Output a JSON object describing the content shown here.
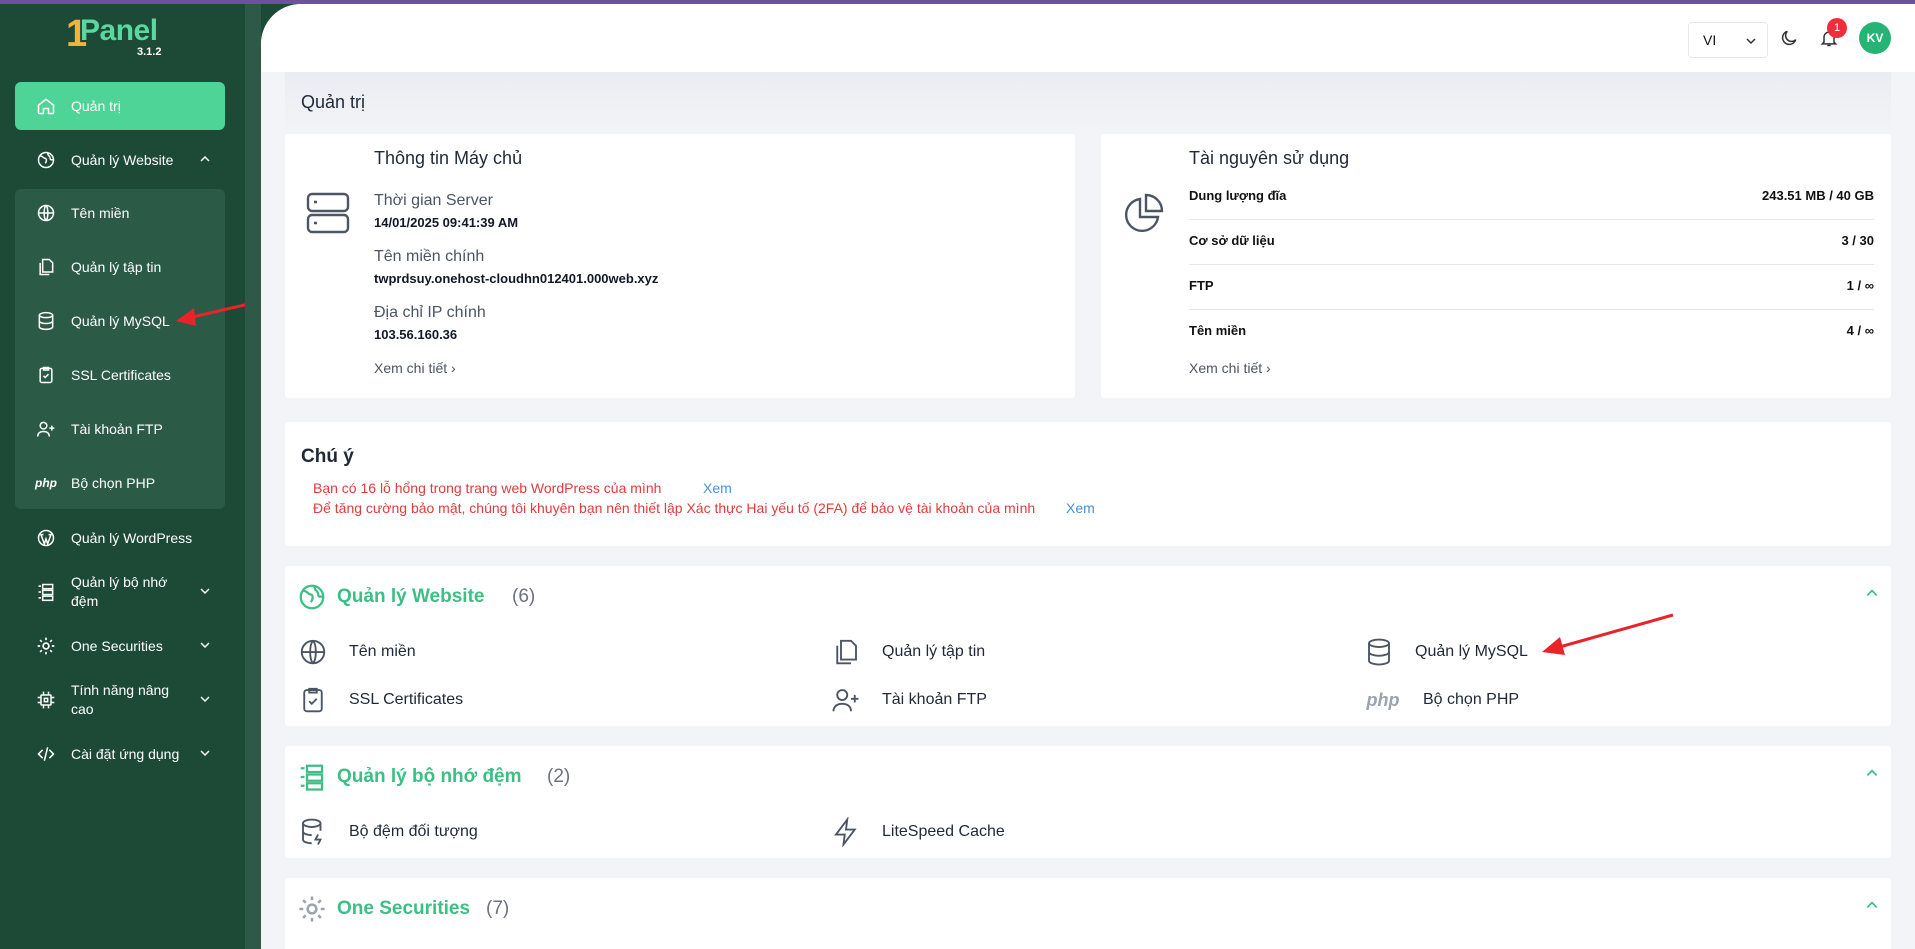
{
  "app": {
    "logo_one": "1",
    "logo_text": "Panel",
    "version": "3.1.2"
  },
  "sidebar": {
    "items": [
      {
        "label": "Quản trị",
        "icon": "home-icon"
      },
      {
        "label": "Quản lý Website",
        "icon": "globe-leaf-icon"
      },
      {
        "label": "Tên miền",
        "icon": "globe-icon"
      },
      {
        "label": "Quản lý tập tin",
        "icon": "files-icon"
      },
      {
        "label": "Quản lý MySQL",
        "icon": "database-icon"
      },
      {
        "label": "SSL Certificates",
        "icon": "clipboard-check-icon"
      },
      {
        "label": "Tài khoản FTP",
        "icon": "user-plus-icon"
      },
      {
        "label": "Bộ chọn PHP",
        "icon": "php-icon"
      },
      {
        "label": "Quản lý WordPress",
        "icon": "wordpress-icon"
      },
      {
        "label": "Quản lý bộ nhớ đệm",
        "icon": "cache-server-icon"
      },
      {
        "label": "One Securities",
        "icon": "gear-icon"
      },
      {
        "label": "Tính năng nâng cao",
        "icon": "chip-icon"
      },
      {
        "label": "Cài đặt ứng dụng",
        "icon": "code-icon"
      }
    ]
  },
  "topbar": {
    "language": "VI",
    "notification_count": "1",
    "avatar_initials": "KV"
  },
  "page": {
    "title": "Quản trị"
  },
  "server_info": {
    "title": "Thông tin Máy chủ",
    "server_time_label": "Thời gian Server",
    "server_time": "14/01/2025 09:41:39 AM",
    "main_domain_label": "Tên miền chính",
    "main_domain": "twprdsuy.onehost-cloudhn012401.000web.xyz",
    "main_ip_label": "Địa chỉ IP chính",
    "main_ip": "103.56.160.36",
    "more": "Xem chi tiết"
  },
  "resources": {
    "title": "Tài nguyên sử dụng",
    "rows": [
      {
        "label": "Dung lượng đĩa",
        "value": "243.51 MB / 40 GB"
      },
      {
        "label": "Cơ sở dữ liệu",
        "value": "3 / 30"
      },
      {
        "label": "FTP",
        "value": "1 / ∞"
      },
      {
        "label": "Tên miền",
        "value": "4 / ∞"
      }
    ],
    "more": "Xem chi tiết"
  },
  "notice": {
    "title": "Chú ý",
    "messages": [
      {
        "text": "Bạn có 16 lỗ hổng trong trang web WordPress của mình",
        "link": "Xem"
      },
      {
        "text": "Để tăng cường bảo mật, chúng tôi khuyên bạn nên thiết lập Xác thực Hai yếu tố (2FA) để bảo vệ tài khoản của mình",
        "link": "Xem"
      }
    ]
  },
  "sections": [
    {
      "title": "Quản lý Website",
      "count": "(6)",
      "items": [
        {
          "label": "Tên miền",
          "icon": "globe-icon"
        },
        {
          "label": "Quản lý tập tin",
          "icon": "files-icon"
        },
        {
          "label": "Quản lý MySQL",
          "icon": "database-icon"
        },
        {
          "label": "SSL Certificates",
          "icon": "clipboard-check-icon"
        },
        {
          "label": "Tài khoản FTP",
          "icon": "user-plus-icon"
        },
        {
          "label": "Bộ chọn PHP",
          "icon": "php-icon"
        }
      ]
    },
    {
      "title": "Quản lý bộ nhớ đệm",
      "count": "(2)",
      "items": [
        {
          "label": "Bộ đệm đối tượng",
          "icon": "database-cache-icon"
        },
        {
          "label": "LiteSpeed Cache",
          "icon": "lightning-icon"
        }
      ]
    },
    {
      "title": "One Securities",
      "count": "(7)",
      "items": []
    }
  ],
  "colors": {
    "sidebar_bg": "#1d4a37",
    "accent": "#4fd497",
    "section_title": "#3cbf84",
    "notice_text": "#e23b3b",
    "arrow": "#e8232a"
  }
}
